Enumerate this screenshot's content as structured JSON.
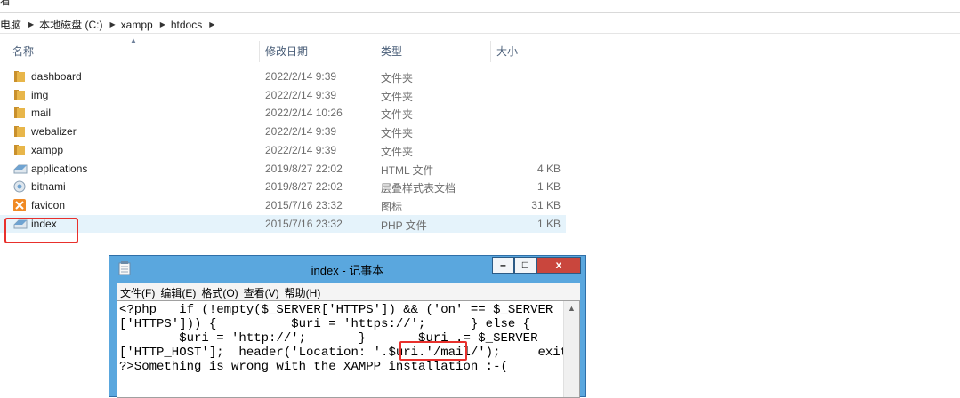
{
  "top_cut_text": "看",
  "breadcrumb": [
    "电脑",
    "本地磁盘 (C:)",
    "xampp",
    "htdocs"
  ],
  "columns": {
    "name": "名称",
    "date": "修改日期",
    "type": "类型",
    "size": "大小"
  },
  "files": [
    {
      "name": "dashboard",
      "date": "2022/2/14 9:39",
      "type": "文件夹",
      "size": "",
      "icon": "folder-icon"
    },
    {
      "name": "img",
      "date": "2022/2/14 9:39",
      "type": "文件夹",
      "size": "",
      "icon": "folder-icon"
    },
    {
      "name": "mail",
      "date": "2022/2/14 10:26",
      "type": "文件夹",
      "size": "",
      "icon": "folder-icon"
    },
    {
      "name": "webalizer",
      "date": "2022/2/14 9:39",
      "type": "文件夹",
      "size": "",
      "icon": "folder-icon"
    },
    {
      "name": "xampp",
      "date": "2022/2/14 9:39",
      "type": "文件夹",
      "size": "",
      "icon": "folder-icon"
    },
    {
      "name": "applications",
      "date": "2019/8/27 22:02",
      "type": "HTML 文件",
      "size": "4 KB",
      "icon": "html-file-icon"
    },
    {
      "name": "bitnami",
      "date": "2019/8/27 22:02",
      "type": "层叠样式表文档",
      "size": "1 KB",
      "icon": "css-file-icon"
    },
    {
      "name": "favicon",
      "date": "2015/7/16 23:32",
      "type": "图标",
      "size": "31 KB",
      "icon": "xampp-ico-icon"
    },
    {
      "name": "index",
      "date": "2015/7/16 23:32",
      "type": "PHP 文件",
      "size": "1 KB",
      "icon": "php-file-icon"
    }
  ],
  "notepad": {
    "title": "index - 记事本",
    "menu": [
      "文件(F)",
      "编辑(E)",
      "格式(O)",
      "查看(V)",
      "帮助(H)"
    ],
    "lines": [
      "<?php   if (!empty($_SERVER['HTTPS']) && ('on' == $_SERVER",
      "['HTTPS'])) {          $uri = 'https://';      } else {",
      "        $uri = 'http://';       }       $uri .= $_SERVER",
      "['HTTP_HOST'];  header('Location: '.$uri.'/mail/');     exit;",
      "?>Something is wrong with the XAMPP installation :-("
    ]
  },
  "colors": {
    "highlight": "#e8302c",
    "folder": "#e8b64a",
    "titlebar": "#5aa7de",
    "selected_row": "#e5f3fb"
  }
}
